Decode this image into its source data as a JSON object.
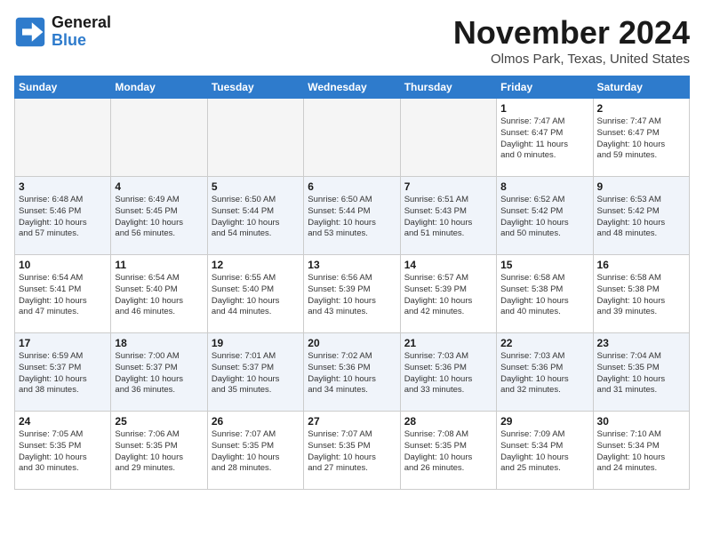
{
  "header": {
    "logo_line1": "General",
    "logo_line2": "Blue",
    "month": "November 2024",
    "location": "Olmos Park, Texas, United States"
  },
  "weekdays": [
    "Sunday",
    "Monday",
    "Tuesday",
    "Wednesday",
    "Thursday",
    "Friday",
    "Saturday"
  ],
  "weeks": [
    [
      {
        "day": "",
        "info": ""
      },
      {
        "day": "",
        "info": ""
      },
      {
        "day": "",
        "info": ""
      },
      {
        "day": "",
        "info": ""
      },
      {
        "day": "",
        "info": ""
      },
      {
        "day": "1",
        "info": "Sunrise: 7:47 AM\nSunset: 6:47 PM\nDaylight: 11 hours\nand 0 minutes."
      },
      {
        "day": "2",
        "info": "Sunrise: 7:47 AM\nSunset: 6:47 PM\nDaylight: 10 hours\nand 59 minutes."
      }
    ],
    [
      {
        "day": "3",
        "info": "Sunrise: 6:48 AM\nSunset: 5:46 PM\nDaylight: 10 hours\nand 57 minutes."
      },
      {
        "day": "4",
        "info": "Sunrise: 6:49 AM\nSunset: 5:45 PM\nDaylight: 10 hours\nand 56 minutes."
      },
      {
        "day": "5",
        "info": "Sunrise: 6:50 AM\nSunset: 5:44 PM\nDaylight: 10 hours\nand 54 minutes."
      },
      {
        "day": "6",
        "info": "Sunrise: 6:50 AM\nSunset: 5:44 PM\nDaylight: 10 hours\nand 53 minutes."
      },
      {
        "day": "7",
        "info": "Sunrise: 6:51 AM\nSunset: 5:43 PM\nDaylight: 10 hours\nand 51 minutes."
      },
      {
        "day": "8",
        "info": "Sunrise: 6:52 AM\nSunset: 5:42 PM\nDaylight: 10 hours\nand 50 minutes."
      },
      {
        "day": "9",
        "info": "Sunrise: 6:53 AM\nSunset: 5:42 PM\nDaylight: 10 hours\nand 48 minutes."
      }
    ],
    [
      {
        "day": "10",
        "info": "Sunrise: 6:54 AM\nSunset: 5:41 PM\nDaylight: 10 hours\nand 47 minutes."
      },
      {
        "day": "11",
        "info": "Sunrise: 6:54 AM\nSunset: 5:40 PM\nDaylight: 10 hours\nand 46 minutes."
      },
      {
        "day": "12",
        "info": "Sunrise: 6:55 AM\nSunset: 5:40 PM\nDaylight: 10 hours\nand 44 minutes."
      },
      {
        "day": "13",
        "info": "Sunrise: 6:56 AM\nSunset: 5:39 PM\nDaylight: 10 hours\nand 43 minutes."
      },
      {
        "day": "14",
        "info": "Sunrise: 6:57 AM\nSunset: 5:39 PM\nDaylight: 10 hours\nand 42 minutes."
      },
      {
        "day": "15",
        "info": "Sunrise: 6:58 AM\nSunset: 5:38 PM\nDaylight: 10 hours\nand 40 minutes."
      },
      {
        "day": "16",
        "info": "Sunrise: 6:58 AM\nSunset: 5:38 PM\nDaylight: 10 hours\nand 39 minutes."
      }
    ],
    [
      {
        "day": "17",
        "info": "Sunrise: 6:59 AM\nSunset: 5:37 PM\nDaylight: 10 hours\nand 38 minutes."
      },
      {
        "day": "18",
        "info": "Sunrise: 7:00 AM\nSunset: 5:37 PM\nDaylight: 10 hours\nand 36 minutes."
      },
      {
        "day": "19",
        "info": "Sunrise: 7:01 AM\nSunset: 5:37 PM\nDaylight: 10 hours\nand 35 minutes."
      },
      {
        "day": "20",
        "info": "Sunrise: 7:02 AM\nSunset: 5:36 PM\nDaylight: 10 hours\nand 34 minutes."
      },
      {
        "day": "21",
        "info": "Sunrise: 7:03 AM\nSunset: 5:36 PM\nDaylight: 10 hours\nand 33 minutes."
      },
      {
        "day": "22",
        "info": "Sunrise: 7:03 AM\nSunset: 5:36 PM\nDaylight: 10 hours\nand 32 minutes."
      },
      {
        "day": "23",
        "info": "Sunrise: 7:04 AM\nSunset: 5:35 PM\nDaylight: 10 hours\nand 31 minutes."
      }
    ],
    [
      {
        "day": "24",
        "info": "Sunrise: 7:05 AM\nSunset: 5:35 PM\nDaylight: 10 hours\nand 30 minutes."
      },
      {
        "day": "25",
        "info": "Sunrise: 7:06 AM\nSunset: 5:35 PM\nDaylight: 10 hours\nand 29 minutes."
      },
      {
        "day": "26",
        "info": "Sunrise: 7:07 AM\nSunset: 5:35 PM\nDaylight: 10 hours\nand 28 minutes."
      },
      {
        "day": "27",
        "info": "Sunrise: 7:07 AM\nSunset: 5:35 PM\nDaylight: 10 hours\nand 27 minutes."
      },
      {
        "day": "28",
        "info": "Sunrise: 7:08 AM\nSunset: 5:35 PM\nDaylight: 10 hours\nand 26 minutes."
      },
      {
        "day": "29",
        "info": "Sunrise: 7:09 AM\nSunset: 5:34 PM\nDaylight: 10 hours\nand 25 minutes."
      },
      {
        "day": "30",
        "info": "Sunrise: 7:10 AM\nSunset: 5:34 PM\nDaylight: 10 hours\nand 24 minutes."
      }
    ]
  ]
}
